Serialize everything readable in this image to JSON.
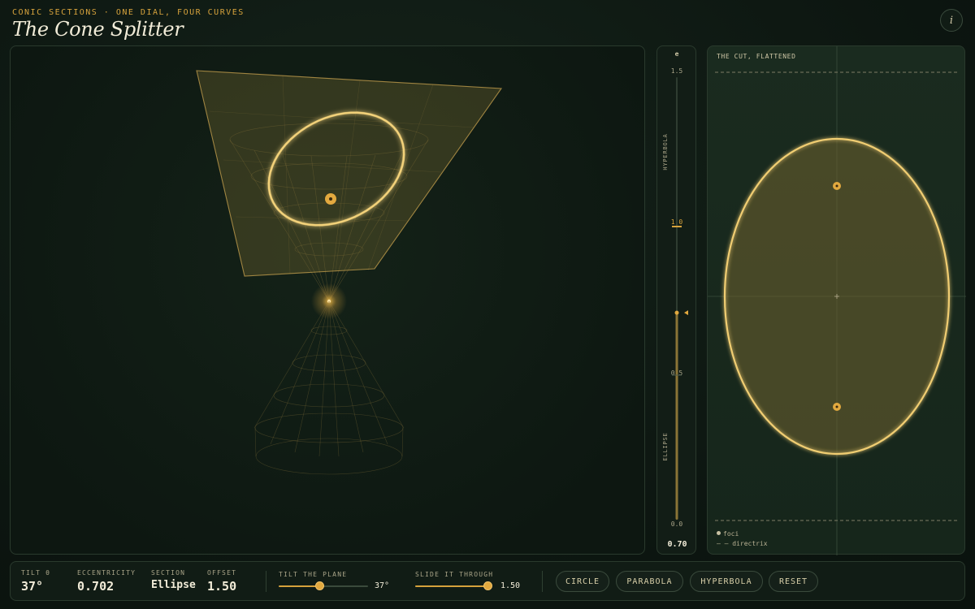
{
  "header": {
    "kicker": "CONIC SECTIONS · ONE DIAL, FOUR CURVES",
    "title": "The Cone Splitter",
    "info_label": "i"
  },
  "dial": {
    "symbol": "e",
    "ticks": [
      "1.5",
      "1.0",
      "0.5",
      "0.0"
    ],
    "hyperbola_label": "HYPERBOLA",
    "ellipse_label": "ELLIPSE",
    "value": "0.70",
    "level": 0.7
  },
  "flat": {
    "title": "THE CUT, FLATTENED",
    "legend_foci": "foci",
    "legend_directrix": "– – directrix"
  },
  "stats": {
    "tilt_label": "TILT θ",
    "tilt_value": "37°",
    "ecc_label": "ECCENTRICITY",
    "ecc_value": "0.702",
    "section_label": "SECTION",
    "section_value": "Ellipse",
    "offset_label": "OFFSET",
    "offset_value": "1.50"
  },
  "controls": {
    "tilt_label": "TILT THE PLANE",
    "tilt_value": "37°",
    "tilt_fraction": 0.46,
    "slide_label": "SLIDE IT THROUGH",
    "slide_value": "1.50",
    "slide_fraction": 0.98
  },
  "buttons": {
    "circle": "CIRCLE",
    "parabola": "PARABOLA",
    "hyperbola": "HYPERBOLA",
    "reset": "RESET"
  },
  "colors": {
    "accent": "#d6a23c",
    "curve": "#f3d27a",
    "background": "#0c1510"
  }
}
